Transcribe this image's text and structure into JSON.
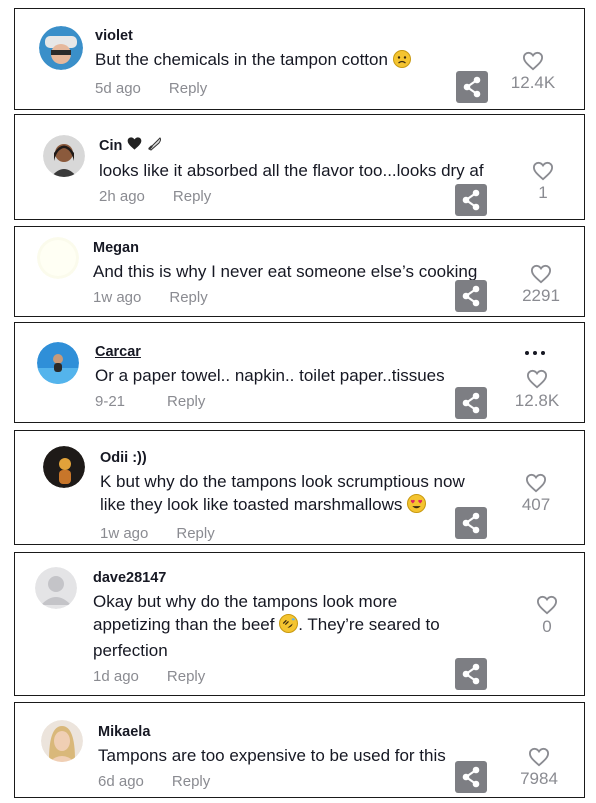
{
  "comments": [
    {
      "username": "violet",
      "text": "But the chemicals in the tampon cotton",
      "time": "5d ago",
      "reply": "Reply",
      "likes": "12.4K",
      "text_emoji": "worried-face-emoji"
    },
    {
      "username": "Cin",
      "text": "looks like it absorbed all the flavor too...looks dry af",
      "time": "2h ago",
      "reply": "Reply",
      "likes": "1",
      "name_emoji": [
        "black-heart-emoji",
        "knife-emoji"
      ]
    },
    {
      "username": "Megan",
      "text": "And this is why I never eat someone else’s cooking",
      "time": "1w ago",
      "reply": "Reply",
      "likes": "2291"
    },
    {
      "username": "Carcar",
      "text": "Or a paper towel.. napkin.. toilet paper..tissues",
      "time": "9-21",
      "reply": "Reply",
      "likes": "12.8K"
    },
    {
      "username": "Odii :))",
      "text_line1": "K but why do the tampons look scrumptious now",
      "text_line2": "like they look like toasted marshmallows",
      "time": "1w ago",
      "reply": "Reply",
      "likes": "407",
      "text_emoji": "heart-eyes-emoji"
    },
    {
      "username": "dave28147",
      "text_line1": "Okay but why do the tampons look more",
      "text_line2a": "appetizing than the beef",
      "text_line2b": ". They’re seared to",
      "text_line3": "perfection",
      "time": "1d ago",
      "reply": "Reply",
      "likes": "0",
      "text_emoji": "rolling-laughing-emoji"
    },
    {
      "username": "Mikaela",
      "text": "Tampons are too expensive to be used for this",
      "time": "6d ago",
      "reply": "Reply",
      "likes": "7984"
    }
  ],
  "icons": {
    "like": "heart-outline-icon",
    "share": "share-icon",
    "more": "more-options-icon"
  },
  "colors": {
    "text": "#161823",
    "muted": "#8a8b91",
    "share_bg": "#7d7e83",
    "border": "#1a1a1a"
  }
}
